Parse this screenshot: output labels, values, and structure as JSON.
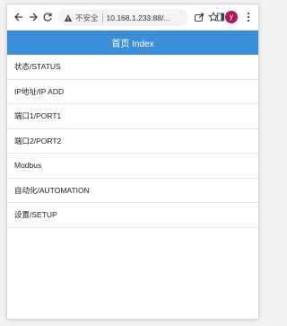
{
  "browser": {
    "security_label": "不安全",
    "url": "10.168.1.233:88/...",
    "profile_initial": "y",
    "accent_color": "#3b8ed8"
  },
  "page": {
    "title": "首页 Index",
    "menu": [
      {
        "label": "状态/STATUS"
      },
      {
        "label": "IP地址/IP ADD"
      },
      {
        "label": "端口1/PORT1"
      },
      {
        "label": "端口2/PORT2"
      },
      {
        "label": "Modbus"
      },
      {
        "label": "自动化/AUTOMATION"
      },
      {
        "label": "设置/SETUP"
      }
    ]
  }
}
